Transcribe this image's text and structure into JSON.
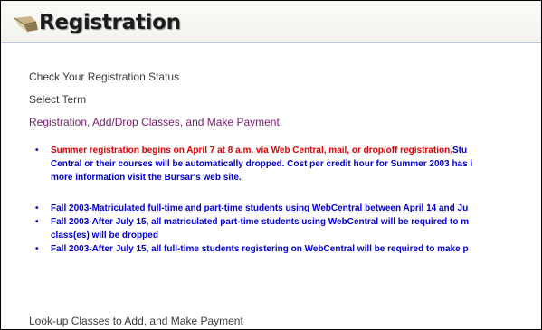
{
  "header": {
    "title": "Registration",
    "icon": "folded-paper-icon"
  },
  "nav": {
    "check_status": "Check Your Registration Status",
    "select_term": "Select Term",
    "registration": "Registration, Add/Drop Classes, and Make Payment",
    "lookup": "Look-up Classes to Add, and Make Payment"
  },
  "notices": [
    {
      "bullet": "•",
      "red_text": "Summer registration begins on April 7 at 8 a.m. via Web Central, mail, or drop/off registration.",
      "line1_blue": "Stu",
      "line2": "Central or their courses will be automatically dropped. Cost per credit hour for Summer 2003 has i",
      "line3": "more information visit the Bursar's web site."
    },
    {
      "bullet": "•",
      "line1": "Fall 2003-Matriculated full-time and part-time students using WebCentral between April 14 and Ju"
    },
    {
      "bullet": "•",
      "line1": "Fall 2003-After July 15, all matriculated part-time students using WebCentral will be required to m",
      "line2": "class(es) will be dropped"
    },
    {
      "bullet": "•",
      "line1": "Fall 2003-After July 15, all full-time students registering on WebCentral will be required to make p"
    }
  ],
  "colors": {
    "link": "#3b3b3b",
    "visited_link": "#7a1a6e",
    "notice_blue": "#0000cc",
    "notice_red": "#e00000"
  }
}
